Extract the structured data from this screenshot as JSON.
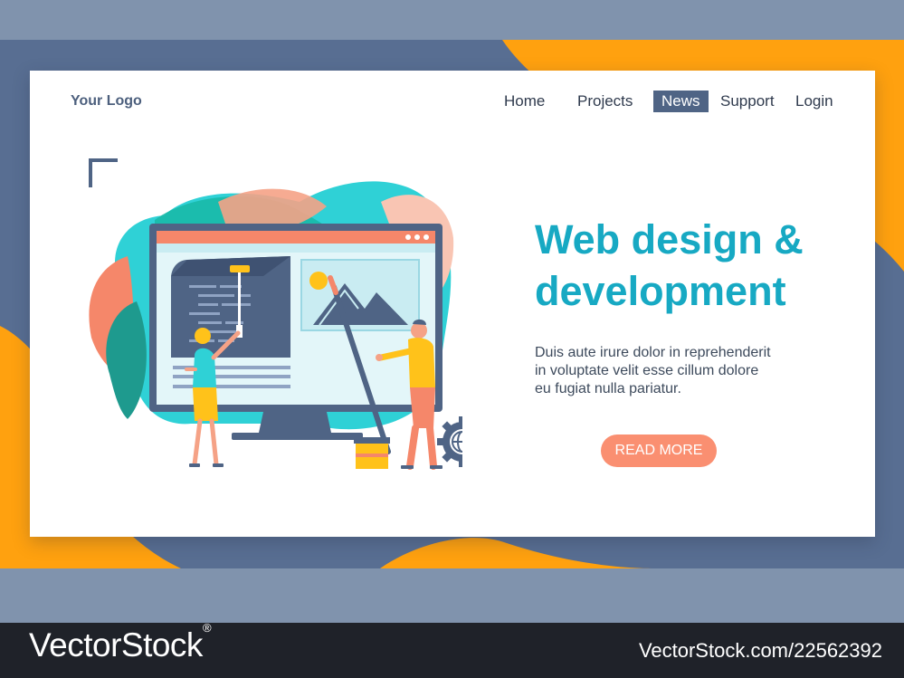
{
  "brand": {
    "logo": "Your Logo"
  },
  "nav": {
    "items": [
      {
        "label": "Home",
        "active": false
      },
      {
        "label": "Projects",
        "active": false
      },
      {
        "label": "News",
        "active": true
      },
      {
        "label": "Support",
        "active": false
      },
      {
        "label": "Login",
        "active": false
      }
    ]
  },
  "hero": {
    "title_line1": "Web design &",
    "title_line2": "development",
    "body": "Duis aute irure dolor in reprehenderit\nin voluptate velit esse  cillum dolore\neu fugiat nulla pariatur.",
    "cta_label": "READ MORE"
  },
  "watermark": {
    "left": "VectorStock",
    "left_mark": "®",
    "right": "VectorStock.com/22562392"
  },
  "colors": {
    "accent_title": "#17a9c3",
    "cta": "#fa8f71",
    "nav_active_bg": "#4f6485",
    "bg_slate": "#8093ad",
    "bg_orange": "#ffa10f",
    "bg_navy": "#586e92"
  },
  "icons": [
    "corner-bracket-icon",
    "gear-globe-icon",
    "paint-roller-icon",
    "paint-brush-icon",
    "paint-bucket-icon"
  ]
}
